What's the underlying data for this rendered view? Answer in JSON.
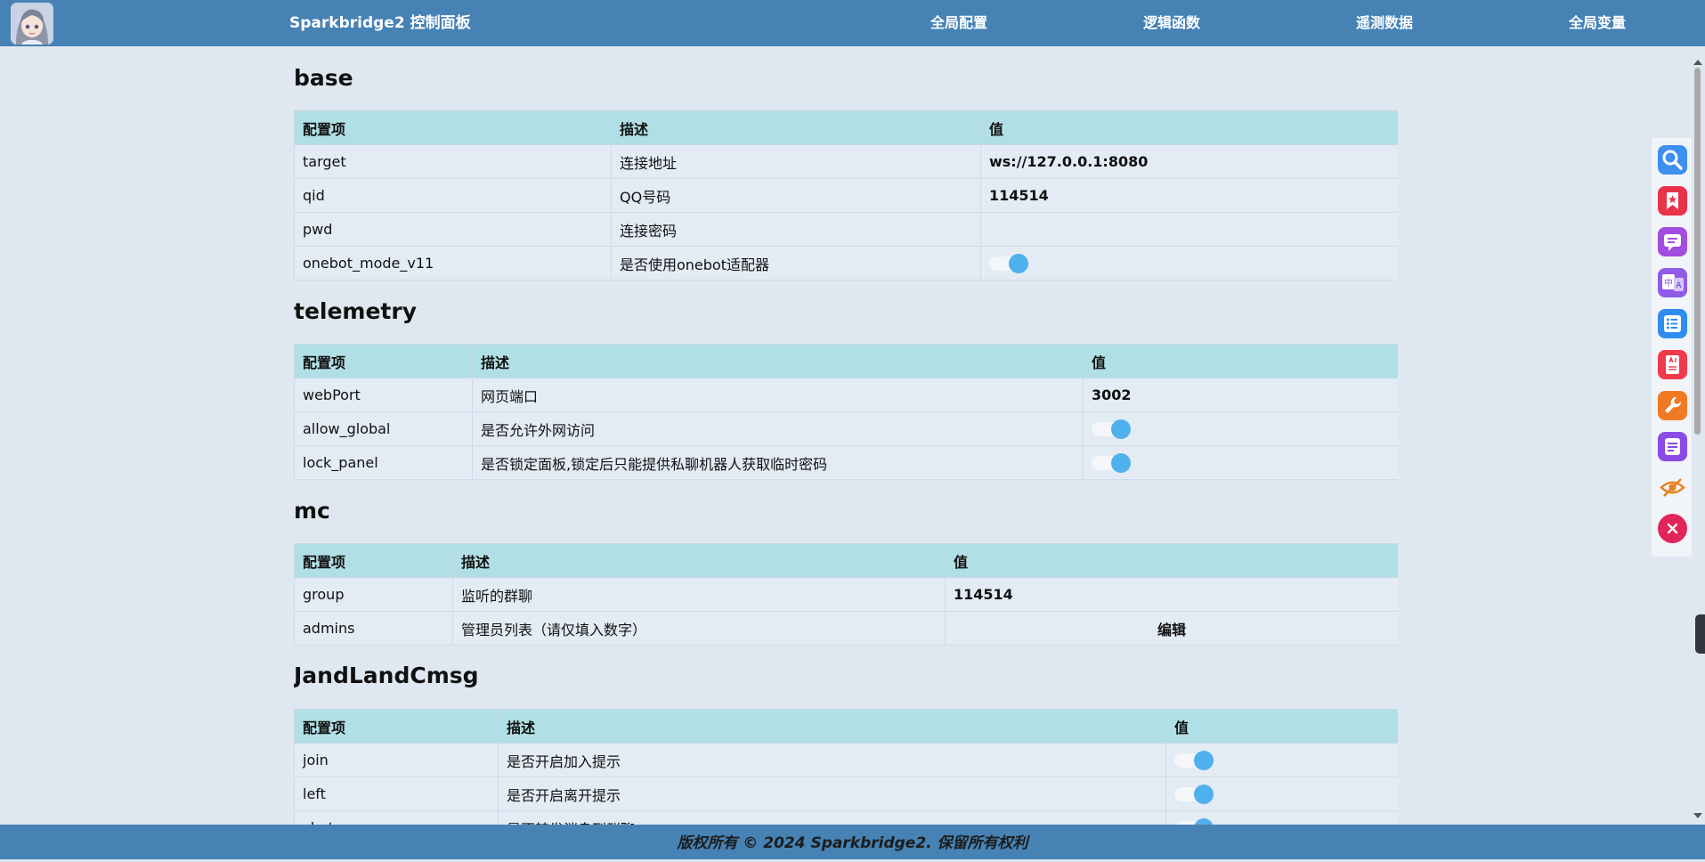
{
  "header": {
    "brand": "Sparkbridge2 控制面板",
    "nav": [
      "全局配置",
      "逻辑函数",
      "遥测数据",
      "全局变量"
    ]
  },
  "columns": {
    "key": "配置项",
    "desc": "描述",
    "value": "值"
  },
  "sections": {
    "base": {
      "title": "base",
      "rows": [
        {
          "key": "target",
          "desc": "连接地址",
          "value": "ws://127.0.0.1:8080"
        },
        {
          "key": "qid",
          "desc": "QQ号码",
          "value": "114514"
        },
        {
          "key": "pwd",
          "desc": "连接密码",
          "value": ""
        },
        {
          "key": "onebot_mode_v11",
          "desc": "是否使用onebot适配器",
          "value": true
        }
      ]
    },
    "telemetry": {
      "title": "telemetry",
      "rows": [
        {
          "key": "webPort",
          "desc": "网页端口",
          "value": "3002"
        },
        {
          "key": "allow_global",
          "desc": "是否允许外网访问",
          "value": true
        },
        {
          "key": "lock_panel",
          "desc": "是否锁定面板,锁定后只能提供私聊机器人获取临时密码",
          "value": true
        }
      ]
    },
    "mc": {
      "title": "mc",
      "rows": [
        {
          "key": "group",
          "desc": "监听的群聊",
          "value": "114514"
        },
        {
          "key": "admins",
          "desc": "管理员列表（请仅填入数字）",
          "value": "编辑"
        }
      ]
    },
    "jandlandcmsg": {
      "title": "JandLandCmsg",
      "rows": [
        {
          "key": "join",
          "desc": "是否开启加入提示",
          "value": true
        },
        {
          "key": "left",
          "desc": "是否开启离开提示",
          "value": true
        },
        {
          "key": "chat",
          "desc": "是否转发消息到群聊",
          "value": true
        }
      ]
    }
  },
  "footer": "版权所有 © 2024 Sparkbridge2. 保留所有权利",
  "toolbar": {
    "icons": [
      "search-icon",
      "bookmark-icon",
      "comment-icon",
      "translate-icon",
      "list-icon",
      "ai-icon",
      "wrench-icon",
      "notes-icon",
      "hide-icon",
      "close-icon"
    ]
  },
  "colors": {
    "header": "#4682b4",
    "background": "#dfe8f1",
    "table_header": "#b0dfe5",
    "toggle": "#4fb0ee"
  }
}
